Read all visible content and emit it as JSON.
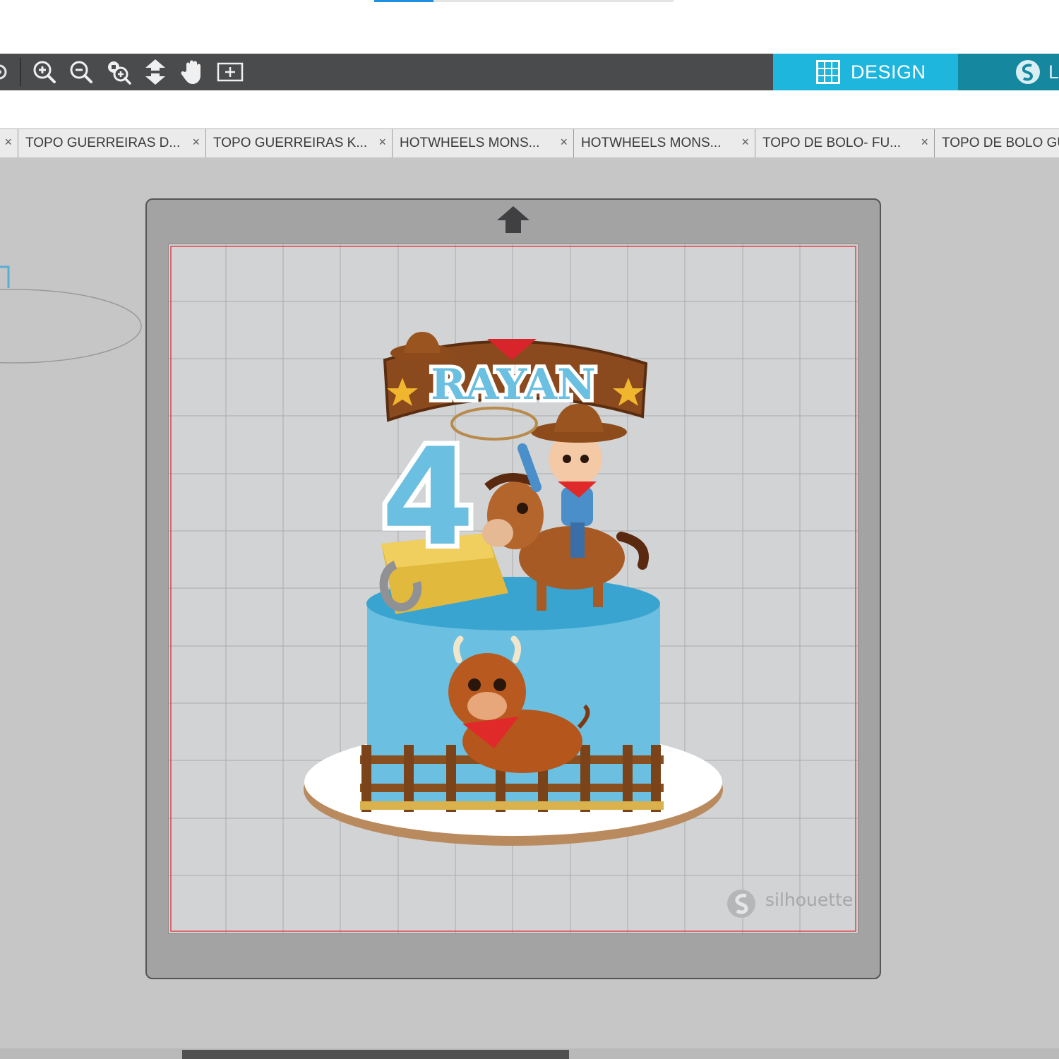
{
  "colors": {
    "toolbar_bg": "#4a4b4c",
    "design_tab": "#1fb6de",
    "library_tab": "#15889f",
    "mat_bg": "#d1d3d4",
    "cut_border": "#e0444c",
    "cake_blue": "#6bbfe0"
  },
  "toolbar": {
    "tools": [
      "zoom-in-icon",
      "zoom-out-icon",
      "zoom-selected-icon",
      "fit-to-page-icon",
      "pan-hand-icon",
      "add-page-icon"
    ],
    "design_label": "DESIGN",
    "library_label": "L"
  },
  "tabs": [
    {
      "label": "TOPO GUERREIRAS D..."
    },
    {
      "label": "TOPO GUERREIRAS K..."
    },
    {
      "label": "HOTWHEELS MONS..."
    },
    {
      "label": "HOTWHEELS MONS..."
    },
    {
      "label": "TOPO DE BOLO- FU..."
    },
    {
      "label": "TOPO DE BOLO GU"
    }
  ],
  "tab_close": "×",
  "design": {
    "name_text": "RAYAN",
    "age_text": "4"
  },
  "watermark": "silhouette"
}
